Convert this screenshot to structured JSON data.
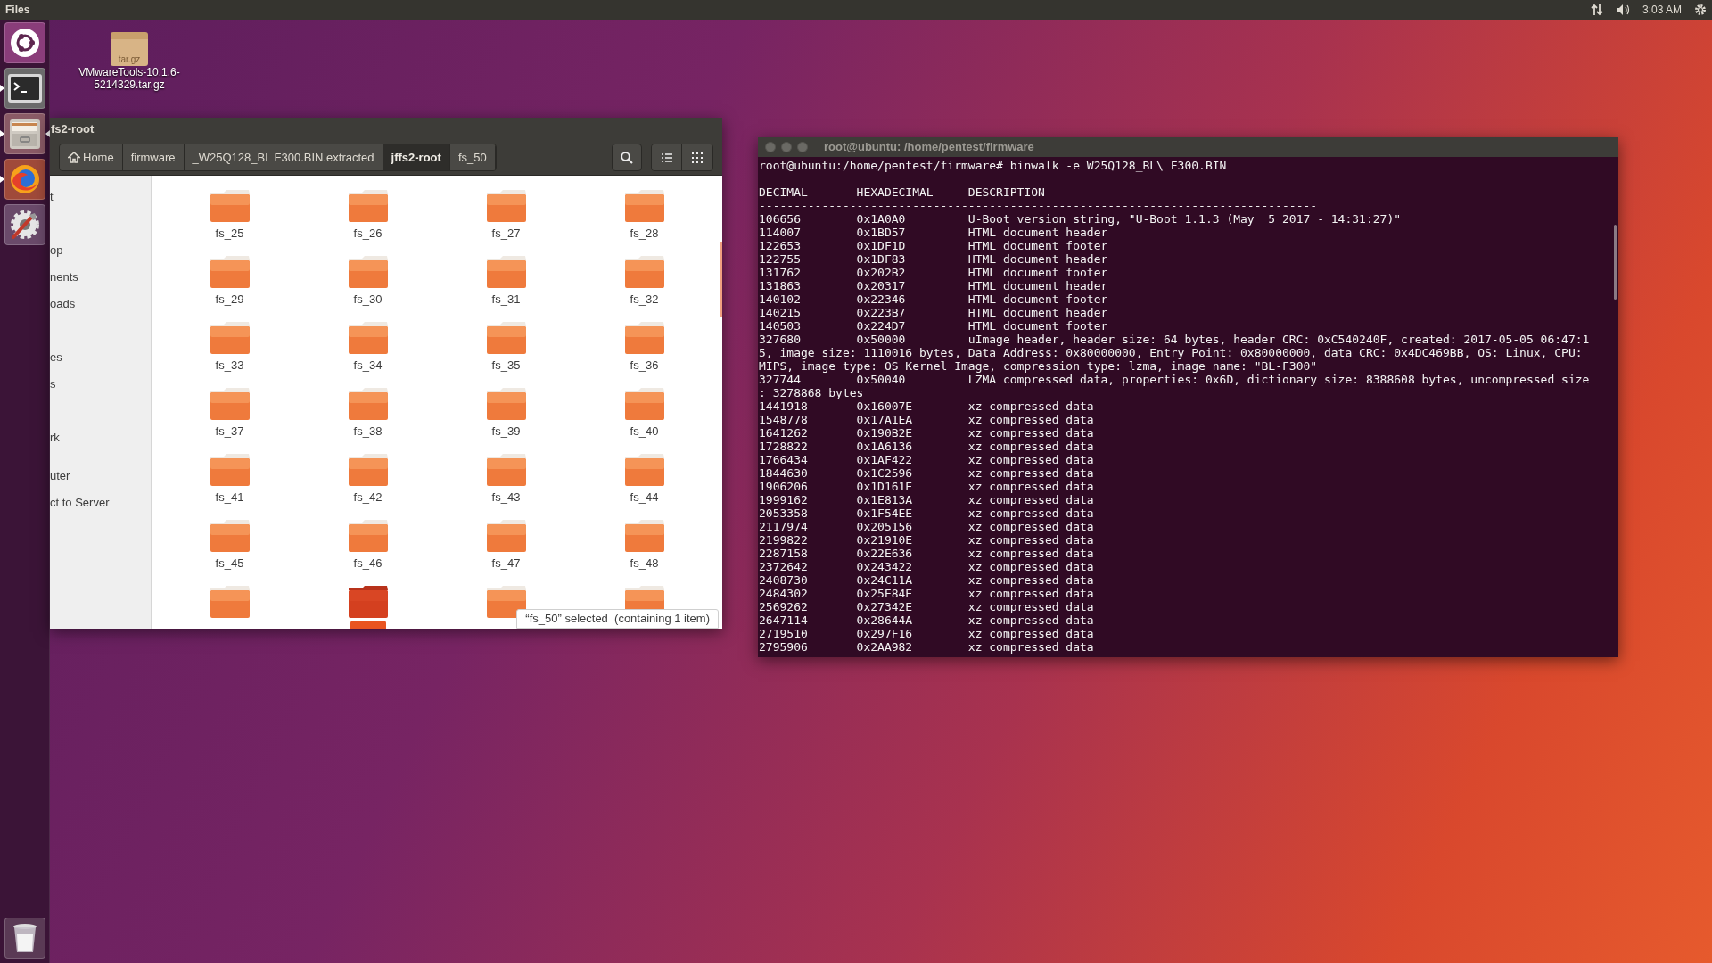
{
  "top_bar": {
    "app_name": "Files",
    "clock": "3:03 AM"
  },
  "launcher": [
    {
      "kind": "dash",
      "running": false,
      "focused": false
    },
    {
      "kind": "terminal",
      "running": true,
      "focused": false
    },
    {
      "kind": "files",
      "running": true,
      "focused": true
    },
    {
      "kind": "browser",
      "running": true,
      "focused": false
    },
    {
      "kind": "settings",
      "running": false,
      "focused": false
    },
    {
      "kind": "trash",
      "running": false,
      "focused": false
    }
  ],
  "desktop_icons": [
    {
      "badge": "tar.gz",
      "label_lines": [
        "VMwareTools-10.1.6-",
        "5214329.tar.gz"
      ]
    }
  ],
  "file_manager": {
    "title": "fs2-root",
    "path": [
      {
        "label": "Home",
        "kind": "home",
        "selected": false
      },
      {
        "label": "firmware",
        "kind": "folder",
        "selected": false
      },
      {
        "label": "_W25Q128_BL F300.BIN.extracted",
        "kind": "folder",
        "selected": false
      },
      {
        "label": "jffs2-root",
        "kind": "folder",
        "selected": true
      },
      {
        "label": "fs_50",
        "kind": "folder",
        "selected": false
      }
    ],
    "sidebar": {
      "places": [
        "t",
        "op",
        "nents",
        "oads",
        "es",
        "s",
        "rk"
      ],
      "other": [
        "uter",
        "ct to Server"
      ]
    },
    "folders": [
      {
        "name": "fs_25",
        "selected": false
      },
      {
        "name": "fs_26",
        "selected": false
      },
      {
        "name": "fs_27",
        "selected": false
      },
      {
        "name": "fs_28",
        "selected": false
      },
      {
        "name": "fs_29",
        "selected": false
      },
      {
        "name": "fs_30",
        "selected": false
      },
      {
        "name": "fs_31",
        "selected": false
      },
      {
        "name": "fs_32",
        "selected": false
      },
      {
        "name": "fs_33",
        "selected": false
      },
      {
        "name": "fs_34",
        "selected": false
      },
      {
        "name": "fs_35",
        "selected": false
      },
      {
        "name": "fs_36",
        "selected": false
      },
      {
        "name": "fs_37",
        "selected": false
      },
      {
        "name": "fs_38",
        "selected": false
      },
      {
        "name": "fs_39",
        "selected": false
      },
      {
        "name": "fs_40",
        "selected": false
      },
      {
        "name": "fs_41",
        "selected": false
      },
      {
        "name": "fs_42",
        "selected": false
      },
      {
        "name": "fs_43",
        "selected": false
      },
      {
        "name": "fs_44",
        "selected": false
      },
      {
        "name": "fs_45",
        "selected": false
      },
      {
        "name": "fs_46",
        "selected": false
      },
      {
        "name": "fs_47",
        "selected": false
      },
      {
        "name": "fs_48",
        "selected": false
      },
      {
        "selected": false
      },
      {
        "selected": true
      },
      {
        "selected": false
      },
      {
        "selected": false
      }
    ],
    "status": "“fs_50” selected  (containing 1 item)"
  },
  "terminal": {
    "title": "root@ubuntu: /home/pentest/firmware",
    "command": "root@ubuntu:/home/pentest/firmware# binwalk -e W25Q128_BL\\ F300.BIN",
    "header": "DECIMAL       HEXADECIMAL     DESCRIPTION",
    "separator": "--------------------------------------------------------------------------------",
    "output": [
      "106656        0x1A0A0         U-Boot version string, \"U-Boot 1.1.3 (May  5 2017 - 14:31:27)\"",
      "114007        0x1BD57         HTML document header",
      "122653        0x1DF1D         HTML document footer",
      "122755        0x1DF83         HTML document header",
      "131762        0x202B2         HTML document footer",
      "131863        0x20317         HTML document header",
      "140102        0x22346         HTML document footer",
      "140215        0x223B7         HTML document header",
      "140503        0x224D7         HTML document footer",
      "327680        0x50000         uImage header, header size: 64 bytes, header CRC: 0xC540240F, created: 2017-05-05 06:47:1",
      "5, image size: 1110016 bytes, Data Address: 0x80000000, Entry Point: 0x80000000, data CRC: 0x4DC469BB, OS: Linux, CPU:",
      "MIPS, image type: OS Kernel Image, compression type: lzma, image name: \"BL-F300\"",
      "327744        0x50040         LZMA compressed data, properties: 0x6D, dictionary size: 8388608 bytes, uncompressed size",
      ": 3278868 bytes",
      "1441918       0x16007E        xz compressed data",
      "1548778       0x17A1EA        xz compressed data",
      "1641262       0x190B2E        xz compressed data",
      "1728822       0x1A6136        xz compressed data",
      "1766434       0x1AF422        xz compressed data",
      "1844630       0x1C2596        xz compressed data",
      "1906206       0x1D161E        xz compressed data",
      "1999162       0x1E813A        xz compressed data",
      "2053358       0x1F54EE        xz compressed data",
      "2117974       0x205156        xz compressed data",
      "2199822       0x21910E        xz compressed data",
      "2287158       0x22E636        xz compressed data",
      "2372642       0x243422        xz compressed data",
      "2408730       0x24C11A        xz compressed data",
      "2484302       0x25E84E        xz compressed data",
      "2569262       0x27342E        xz compressed data",
      "2647114       0x28644A        xz compressed data",
      "2719510       0x297F16        xz compressed data",
      "2795906       0x2AA982        xz compressed data"
    ]
  }
}
